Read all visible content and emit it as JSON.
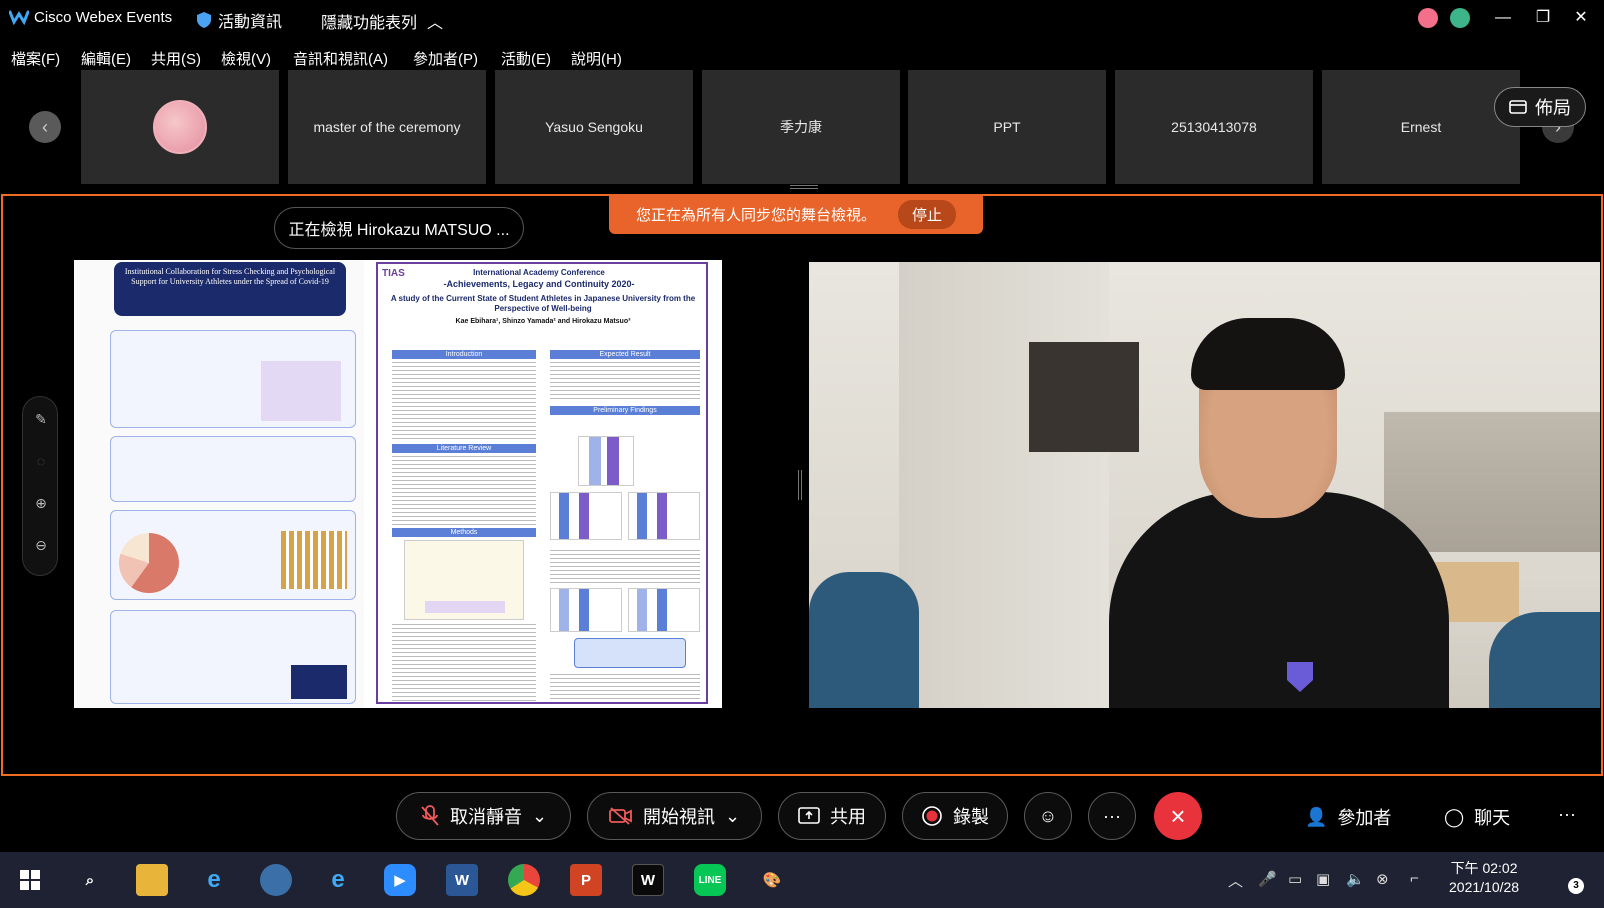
{
  "titlebar": {
    "app_title": "Cisco Webex Events",
    "event_info": "活動資訊",
    "hide_features": "隱藏功能表列"
  },
  "menu": [
    "檔案(F)",
    "編輯(E)",
    "共用(S)",
    "檢視(V)",
    "音訊和視訊(A)",
    "參加者(P)",
    "活動(E)",
    "說明(H)"
  ],
  "participants": [
    "master of the ceremony",
    "Yasuo Sengoku",
    "季力康",
    "PPT",
    "25130413078",
    "Ernest"
  ],
  "layout_label": "佈局",
  "stage": {
    "sync_banner": "您正在為所有人同步您的舞台檢視。",
    "stop_label": "停止",
    "viewing_label": "正在檢視 Hirokazu MATSUO ..."
  },
  "poster": {
    "left_title": "Institutional Collaboration for Stress Checking and Psychological Support for University Athletes under the Spread of Covid-19",
    "conference": "International Academy Conference",
    "conference_sub": "-Achievements, Legacy and Continuity 2020-",
    "title": "A study of the Current State of Student Athletes in Japanese University from the Perspective of Well-being",
    "authors": "Kae Ebihara¹, Shinzo Yamada² and Hirokazu Matsuo³",
    "tias": "TIAS",
    "sections": [
      "Introduction",
      "Literature Review",
      "Methods",
      "Expected Result",
      "Preliminary Findings"
    ]
  },
  "controls": {
    "unmute": "取消靜音",
    "start_video": "開始視訊",
    "share": "共用",
    "record": "錄製",
    "participants": "參加者",
    "chat": "聊天"
  },
  "taskbar": {
    "time": "下午 02:02",
    "date": "2021/10/28",
    "notification_count": "3"
  },
  "colors": {
    "accent_orange": "#f26b22",
    "end_red": "#e8323c",
    "poster_purple": "#6a3fa0",
    "poster_blue": "#5b7fd6"
  }
}
